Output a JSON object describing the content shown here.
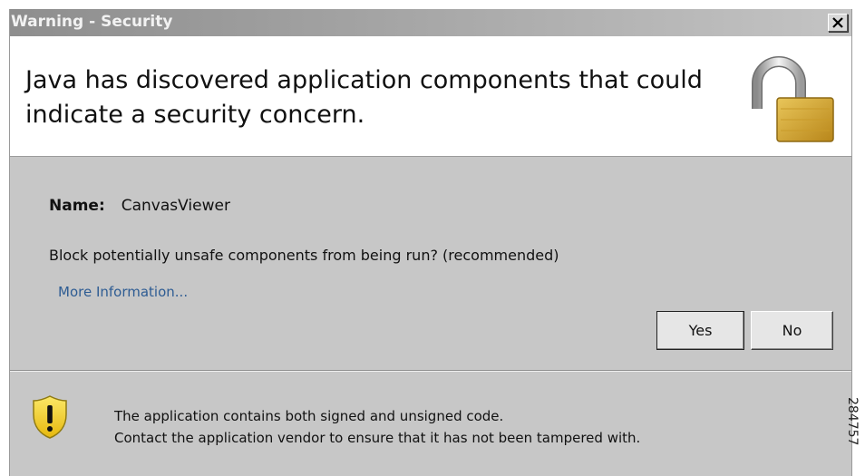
{
  "window": {
    "title": "Warning - Security",
    "close_label": "×"
  },
  "header": {
    "message": "Java has discovered application components that could indicate a security concern.",
    "icon": "padlock-open-icon"
  },
  "details": {
    "name_label": "Name:",
    "name_value": "CanvasViewer",
    "question": "Block potentially unsafe components from being run? (recommended)",
    "more_info_link": "More Information..."
  },
  "buttons": {
    "yes_label": "Yes",
    "no_label": "No"
  },
  "footer": {
    "icon": "warning-shield-icon",
    "line1": "The application contains both signed and unsigned code.",
    "line2": "Contact the application vendor to ensure that it has not been tampered with."
  },
  "figure_id": "284757",
  "colors": {
    "title_bar": "#9a9a9a",
    "body_background": "#c7c7c7",
    "link": "#2e5c93",
    "lock_gold": "#d4a52a",
    "shield_yellow": "#f2d21b"
  }
}
